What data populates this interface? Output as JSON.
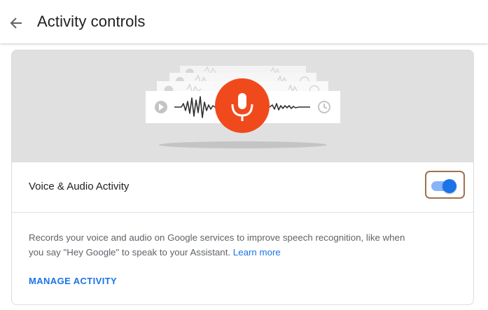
{
  "header": {
    "title": "Activity controls",
    "back_icon": "arrow-left-icon"
  },
  "hero": {
    "icon": "microphone-icon",
    "accent_color": "#f04a1c"
  },
  "voice_activity": {
    "label": "Voice & Audio Activity",
    "toggle_state": "on"
  },
  "description": {
    "text": "Records your voice and audio on Google services to improve speech recognition, like when you say \"Hey Google\" to speak to your Assistant.",
    "link_label": "Learn more"
  },
  "actions": {
    "manage_label": "MANAGE ACTIVITY"
  },
  "colors": {
    "link": "#1a73e8",
    "toggle_track": "#8ab4f8",
    "toggle_thumb": "#1a73e8",
    "highlight_border": "#a0714f"
  }
}
